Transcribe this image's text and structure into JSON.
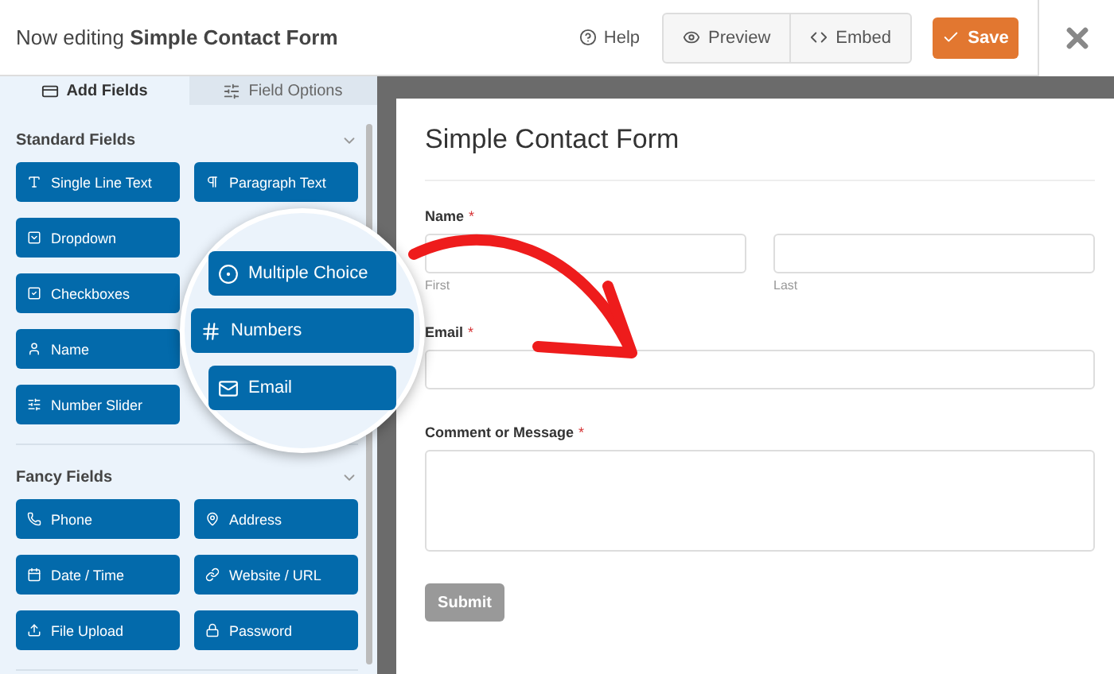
{
  "header": {
    "prefix": "Now editing",
    "form_name": "Simple Contact Form",
    "help": "Help",
    "preview": "Preview",
    "embed": "Embed",
    "save": "Save"
  },
  "tabs": [
    {
      "label": "Add Fields",
      "selected": true
    },
    {
      "label": "Field Options",
      "selected": false
    }
  ],
  "sections": [
    {
      "title": "Standard Fields",
      "left_fields": [
        "Single Line Text",
        "Dropdown",
        "Checkboxes",
        "Name",
        "Number Slider"
      ],
      "right_fields": [
        "Paragraph Text"
      ]
    },
    {
      "title": "Fancy Fields",
      "left_fields": [
        "Phone",
        "Date / Time",
        "File Upload"
      ],
      "right_fields": [
        "Address",
        "Website / URL",
        "Password"
      ]
    }
  ],
  "magnifier": [
    "Multiple Choice",
    "Numbers",
    "Email"
  ],
  "form": {
    "title": "Simple Contact Form",
    "name_label": "Name",
    "first": "First",
    "last": "Last",
    "email_label": "Email",
    "comment_label": "Comment or Message",
    "required": "*",
    "submit": "Submit"
  }
}
